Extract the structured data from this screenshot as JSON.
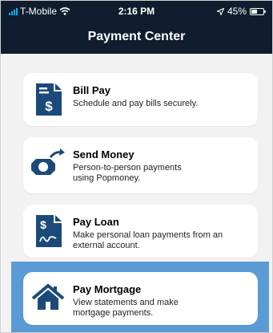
{
  "status_bar": {
    "carrier": "T-Mobile",
    "time": "2:16 PM",
    "battery": "45%",
    "battery_level": 0.45
  },
  "header": {
    "title": "Payment Center"
  },
  "colors": {
    "header_bg": "#0f1d2e",
    "icon_blue": "#1b4a7a",
    "highlight": "#5b9bd5"
  },
  "items": [
    {
      "name": "Bill Pay",
      "desc": "Schedule and pay bills securely.",
      "icon": "bill-pay-icon"
    },
    {
      "name": "Send Money",
      "desc": "Person-to-person payments using Popmoney.",
      "icon": "send-money-icon"
    },
    {
      "name": "Pay Loan",
      "desc": "Make personal loan payments from an external account.",
      "icon": "pay-loan-icon"
    },
    {
      "name": "Pay Mortgage",
      "desc": "View statements and make mortgage payments.",
      "icon": "house-icon"
    }
  ]
}
